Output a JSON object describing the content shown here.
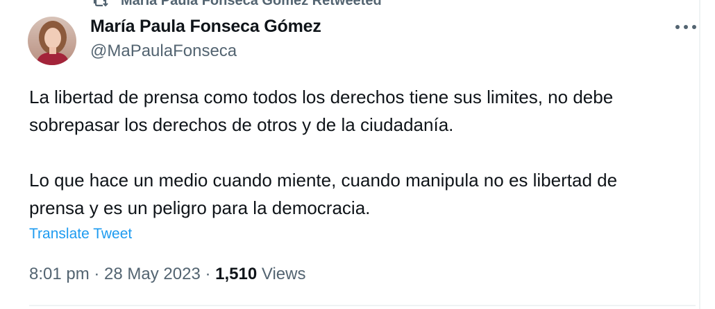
{
  "retweet": {
    "label": "María Paula Fonseca Gómez Retweeted",
    "icon": "retweet-icon"
  },
  "author": {
    "display_name": "María Paula Fonseca Gómez",
    "handle": "@MaPaulaFonseca",
    "avatar_icon": "profile-photo"
  },
  "tweet": {
    "paragraphs": [
      "La libertad de prensa como todos los derechos tiene sus limites, no debe\nsobrepasar los derechos de otros y de la ciudadanía.",
      "Lo que hace un medio cuando miente, cuando manipula no es libertad de\nprensa y es un peligro para la democracia."
    ],
    "translate_label": "Translate Tweet"
  },
  "meta": {
    "time": "8:01 pm",
    "separator": " · ",
    "date": "28 May 2023",
    "views_count": "1,510",
    "views_label": " Views"
  },
  "colors": {
    "link": "#1d9bf0",
    "secondary_text": "#536471",
    "primary_text": "#0f1419"
  }
}
